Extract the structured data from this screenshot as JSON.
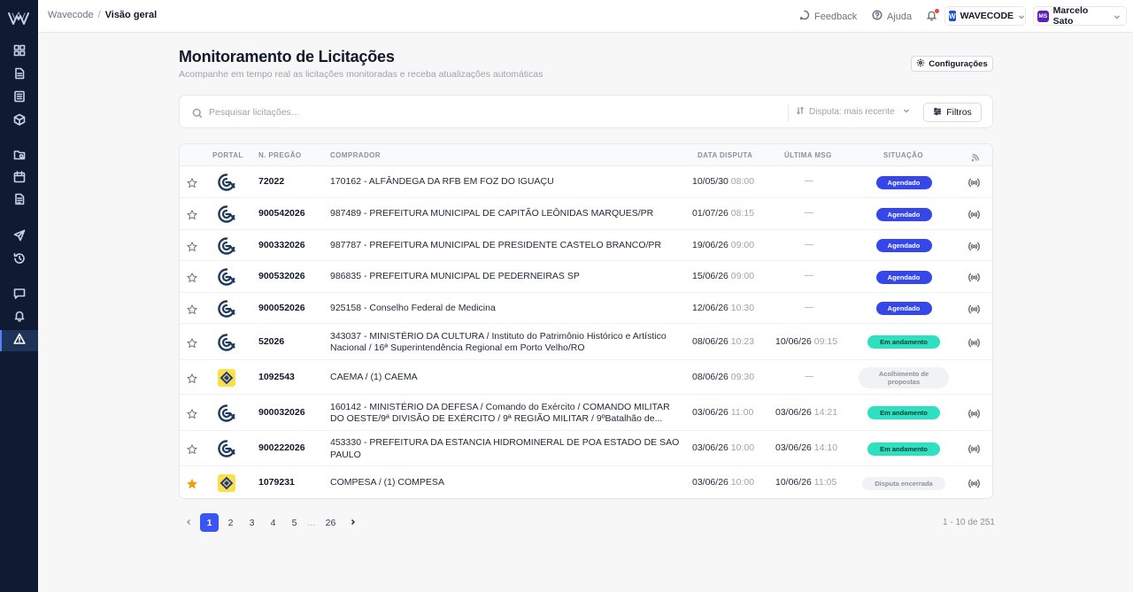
{
  "sidebar": {
    "logo": "wavecode-logo",
    "items": [
      {
        "icon": "grid-icon"
      },
      {
        "icon": "file-icon"
      },
      {
        "icon": "newspaper-icon"
      },
      {
        "icon": "cube-icon"
      },
      {
        "icon": "folder-search-icon"
      },
      {
        "icon": "calendar-icon"
      },
      {
        "icon": "document-icon"
      },
      {
        "icon": "send-icon"
      },
      {
        "icon": "history-icon"
      },
      {
        "icon": "message-icon"
      },
      {
        "icon": "bell-icon"
      },
      {
        "icon": "alert-triangle-icon",
        "active": true
      }
    ],
    "accent": "#5b7cff"
  },
  "topbar": {
    "crumb_root": "Wavecode",
    "crumb_sep": "/",
    "crumb_current": "Visão geral",
    "feedback": "Feedback",
    "help": "Ajuda",
    "workspace": "WAVECODE",
    "workspace_initial": "W",
    "user": "Marcelo Sato",
    "user_initials": "MS"
  },
  "header": {
    "title": "Monitoramento de Licitações",
    "subtitle": "Acompanhe em tempo real as licitações monitoradas e receba atualizações automáticas",
    "config_button": "Configurações"
  },
  "search": {
    "placeholder": "Pesquisar licitações...",
    "value": "",
    "sort_label": "Disputa: mais recente",
    "filter_button": "Filtros"
  },
  "table": {
    "columns": {
      "portal": "PORTAL",
      "pregao": "N. PREGÃO",
      "comprador": "COMPRADOR",
      "data_disputa": "DATA DISPUTA",
      "ultima_msg": "ÚLTIMA MSG",
      "situacao": "SITUAÇÃO"
    },
    "rows": [
      {
        "starred": false,
        "portal": "comprasgov",
        "pregao": "72022",
        "comprador": "170162 - ALFÂNDEGA DA RFB EM FOZ DO IGUAÇU",
        "date": "10/05/30",
        "time": "08:00",
        "msg_date": "—",
        "msg_time": "",
        "status": "Agendado",
        "status_type": "agendado",
        "radar": true
      },
      {
        "starred": false,
        "portal": "comprasgov",
        "pregao": "900542026",
        "comprador": "987489 - PREFEITURA MUNICIPAL DE CAPITÃO LEÔNIDAS MARQUES/PR",
        "date": "01/07/26",
        "time": "08:15",
        "msg_date": "—",
        "msg_time": "",
        "status": "Agendado",
        "status_type": "agendado",
        "radar": true
      },
      {
        "starred": false,
        "portal": "comprasgov",
        "pregao": "900332026",
        "comprador": "987787 - PREFEITURA MUNICIPAL DE PRESIDENTE CASTELO BRANCO/PR",
        "date": "19/06/26",
        "time": "09:00",
        "msg_date": "—",
        "msg_time": "",
        "status": "Agendado",
        "status_type": "agendado",
        "radar": true
      },
      {
        "starred": false,
        "portal": "comprasgov",
        "pregao": "900532026",
        "comprador": "986835 - PREFEITURA MUNICIPAL DE PEDERNEIRAS SP",
        "date": "15/06/26",
        "time": "09:00",
        "msg_date": "—",
        "msg_time": "",
        "status": "Agendado",
        "status_type": "agendado",
        "radar": true
      },
      {
        "starred": false,
        "portal": "comprasgov",
        "pregao": "900052026",
        "comprador": "925158 - Conselho Federal de Medicina",
        "date": "12/06/26",
        "time": "10:30",
        "msg_date": "—",
        "msg_time": "",
        "status": "Agendado",
        "status_type": "agendado",
        "radar": true
      },
      {
        "starred": false,
        "portal": "comprasgov",
        "pregao": "52026",
        "comprador": "343037 - MINISTÉRIO DA CULTURA / Instituto do Patrimônio Histórico e Artístico Nacional / 16ª Superintendência Regional em Porto Velho/RO",
        "date": "08/06/26",
        "time": "10:23",
        "msg_date": "10/06/26",
        "msg_time": "09:15",
        "status": "Em andamento",
        "status_type": "andamento",
        "radar": true
      },
      {
        "starred": false,
        "portal": "bb",
        "pregao": "1092543",
        "comprador": "CAEMA / (1) CAEMA",
        "date": "08/06/26",
        "time": "09:30",
        "msg_date": "—",
        "msg_time": "",
        "status": "Acolhimento de propostas",
        "status_type": "gray",
        "radar": false
      },
      {
        "starred": false,
        "portal": "comprasgov",
        "pregao": "900032026",
        "comprador": "160142 - MINISTÉRIO DA DEFESA / Comando do Exército / COMANDO MILITAR DO OESTE/9ª DIVISÃO DE EXÉRCITO / 9ª REGIÃO MILITAR / 9ºBatalhão de...",
        "date": "03/06/26",
        "time": "11:00",
        "msg_date": "03/06/26",
        "msg_time": "14:21",
        "status": "Em andamento",
        "status_type": "andamento",
        "radar": true
      },
      {
        "starred": false,
        "portal": "comprasgov",
        "pregao": "900222026",
        "comprador": "453330 - PREFEITURA DA ESTANCIA HIDROMINERAL DE POA ESTADO DE SAO PAULO",
        "date": "03/06/26",
        "time": "10:00",
        "msg_date": "03/06/26",
        "msg_time": "14:10",
        "status": "Em andamento",
        "status_type": "andamento",
        "radar": true
      },
      {
        "starred": true,
        "portal": "bb",
        "pregao": "1079231",
        "comprador": "COMPESA / (1) COMPESA",
        "date": "03/06/26",
        "time": "10:00",
        "msg_date": "10/06/26",
        "msg_time": "11:05",
        "status": "Disputa encerrada",
        "status_type": "gray",
        "radar": true
      }
    ]
  },
  "pagination": {
    "pages": [
      "1",
      "2",
      "3",
      "4",
      "5",
      "...",
      "26"
    ],
    "current": "1",
    "info": "1 - 10 de 251"
  },
  "colors": {
    "agendado": "#3547e8",
    "andamento": "#2fe0c0",
    "star_active": "#f59e0b",
    "primary": "#3a55f5"
  }
}
